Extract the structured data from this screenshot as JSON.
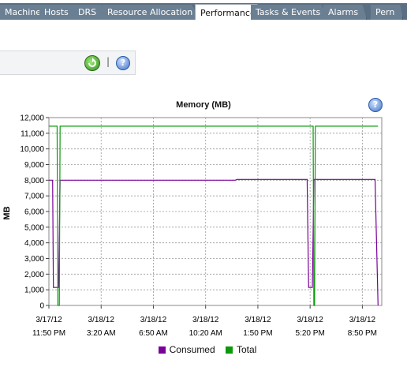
{
  "tabs": [
    "Machines",
    "Hosts",
    "DRS",
    "Resource Allocation",
    "Performance",
    "Tasks & Events",
    "Alarms",
    "Pern"
  ],
  "active_tab": "Performance",
  "toolbar": {
    "separator": "|",
    "help_glyph": "?"
  },
  "colors": {
    "consumed": "#7a0099",
    "total": "#0a9a0a"
  },
  "chart_data": {
    "type": "line",
    "title": "Memory (MB)",
    "ylabel": "MB",
    "ylim": [
      0,
      12000
    ],
    "yticks": [
      "0",
      "1,000",
      "2,000",
      "3,000",
      "4,000",
      "5,000",
      "6,000",
      "7,000",
      "8,000",
      "9,000",
      "10,000",
      "11,000",
      "12,000"
    ],
    "xticks": [
      {
        "date": "3/17/12",
        "time": "11:50 PM"
      },
      {
        "date": "3/18/12",
        "time": "3:20 AM"
      },
      {
        "date": "3/18/12",
        "time": "6:50 AM"
      },
      {
        "date": "3/18/12",
        "time": "10:20 AM"
      },
      {
        "date": "3/18/12",
        "time": "1:50 PM"
      },
      {
        "date": "3/18/12",
        "time": "5:20 PM"
      },
      {
        "date": "3/18/12",
        "time": "8:50 PM"
      }
    ],
    "grid": true,
    "legend": "bottom",
    "series": [
      {
        "name": "Consumed",
        "points": [
          [
            0.0,
            8000
          ],
          [
            0.25,
            8000
          ],
          [
            0.3,
            1150
          ],
          [
            0.65,
            1150
          ],
          [
            0.75,
            8000
          ],
          [
            12.5,
            8000
          ],
          [
            12.6,
            8050
          ],
          [
            17.3,
            8050
          ],
          [
            17.4,
            1150
          ],
          [
            17.65,
            1150
          ],
          [
            17.75,
            8050
          ],
          [
            21.85,
            8050
          ],
          [
            22.05,
            0
          ]
        ]
      },
      {
        "name": "Total",
        "points": [
          [
            0.0,
            11450
          ],
          [
            0.55,
            11450
          ],
          [
            0.6,
            0
          ],
          [
            0.7,
            0
          ],
          [
            0.75,
            11450
          ],
          [
            17.7,
            11450
          ],
          [
            17.75,
            0
          ],
          [
            17.8,
            0
          ],
          [
            17.85,
            11450
          ],
          [
            22.05,
            11450
          ]
        ]
      }
    ]
  }
}
